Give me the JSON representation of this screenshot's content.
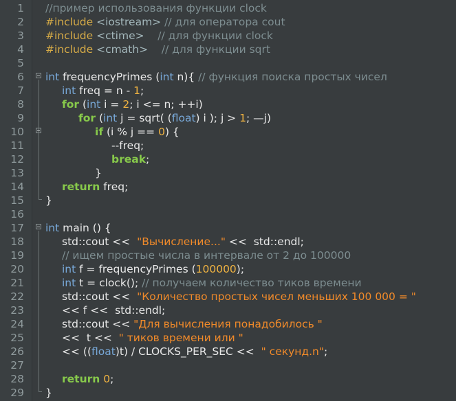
{
  "editor": {
    "lines": [
      {
        "n": "1",
        "indent": 0,
        "tokens": [
          {
            "t": "//пример использования функции clock",
            "c": "comment"
          }
        ]
      },
      {
        "n": "2",
        "indent": 0,
        "tokens": [
          {
            "t": "#include ",
            "c": "pre"
          },
          {
            "t": "<iostream>",
            "c": "angle"
          },
          {
            "t": " // для оператора cout",
            "c": "comment"
          }
        ]
      },
      {
        "n": "3",
        "indent": 0,
        "tokens": [
          {
            "t": "#include ",
            "c": "pre"
          },
          {
            "t": "<ctime>",
            "c": "angle"
          },
          {
            "t": "    // для функции clock",
            "c": "comment"
          }
        ]
      },
      {
        "n": "4",
        "indent": 0,
        "tokens": [
          {
            "t": "#include ",
            "c": "pre"
          },
          {
            "t": "<cmath>",
            "c": "angle"
          },
          {
            "t": "    // для функции sqrt",
            "c": "comment"
          }
        ]
      },
      {
        "n": "5",
        "indent": 0,
        "tokens": []
      },
      {
        "n": "6",
        "indent": 0,
        "tokens": [
          {
            "t": "int",
            "c": "type"
          },
          {
            "t": " frequencyPrimes (",
            "c": "id"
          },
          {
            "t": "int",
            "c": "type"
          },
          {
            "t": " n){ ",
            "c": "id"
          },
          {
            "t": "// функция поиска простых чисел",
            "c": "comment"
          }
        ]
      },
      {
        "n": "7",
        "indent": 1,
        "tokens": [
          {
            "t": "int",
            "c": "type"
          },
          {
            "t": " freq = n - ",
            "c": "id"
          },
          {
            "t": "1",
            "c": "num"
          },
          {
            "t": ";",
            "c": "id"
          }
        ]
      },
      {
        "n": "8",
        "indent": 1,
        "tokens": [
          {
            "t": "for",
            "c": "kw"
          },
          {
            "t": " (",
            "c": "id"
          },
          {
            "t": "int",
            "c": "type"
          },
          {
            "t": " i = ",
            "c": "id"
          },
          {
            "t": "2",
            "c": "num"
          },
          {
            "t": "; i <= n; ++i)",
            "c": "id"
          }
        ]
      },
      {
        "n": "9",
        "indent": 2,
        "tokens": [
          {
            "t": "for",
            "c": "kw"
          },
          {
            "t": " (",
            "c": "id"
          },
          {
            "t": "int",
            "c": "type"
          },
          {
            "t": " j = sqrt( (",
            "c": "id"
          },
          {
            "t": "float",
            "c": "type"
          },
          {
            "t": ") i ); j > ",
            "c": "id"
          },
          {
            "t": "1",
            "c": "num"
          },
          {
            "t": "; —j)",
            "c": "id"
          }
        ]
      },
      {
        "n": "10",
        "indent": 3,
        "tokens": [
          {
            "t": "if",
            "c": "kw"
          },
          {
            "t": " (i % j == ",
            "c": "id"
          },
          {
            "t": "0",
            "c": "num"
          },
          {
            "t": ") {",
            "c": "id"
          }
        ]
      },
      {
        "n": "11",
        "indent": 4,
        "tokens": [
          {
            "t": "--freq;",
            "c": "id"
          }
        ]
      },
      {
        "n": "12",
        "indent": 4,
        "tokens": [
          {
            "t": "break",
            "c": "kw"
          },
          {
            "t": ";",
            "c": "id"
          }
        ]
      },
      {
        "n": "13",
        "indent": 3,
        "tokens": [
          {
            "t": "}",
            "c": "id"
          }
        ]
      },
      {
        "n": "14",
        "indent": 1,
        "tokens": [
          {
            "t": "return",
            "c": "kw"
          },
          {
            "t": " freq;",
            "c": "id"
          }
        ]
      },
      {
        "n": "15",
        "indent": 0,
        "tokens": [
          {
            "t": "}",
            "c": "id"
          }
        ]
      },
      {
        "n": "16",
        "indent": 0,
        "tokens": []
      },
      {
        "n": "17",
        "indent": 0,
        "tokens": [
          {
            "t": "int",
            "c": "type"
          },
          {
            "t": " main () {",
            "c": "id"
          }
        ]
      },
      {
        "n": "18",
        "indent": 1,
        "tokens": [
          {
            "t": "std::cout << ",
            "c": "id"
          },
          {
            "t": " \"Вычисление...\"",
            "c": "str"
          },
          {
            "t": " << ",
            "c": "id"
          },
          {
            "t": " std::endl;",
            "c": "id"
          }
        ]
      },
      {
        "n": "19",
        "indent": 1,
        "tokens": [
          {
            "t": "// ищем простые числа в интервале от 2 до 100000",
            "c": "comment"
          }
        ]
      },
      {
        "n": "20",
        "indent": 1,
        "tokens": [
          {
            "t": "int",
            "c": "type"
          },
          {
            "t": " f = frequencyPrimes (",
            "c": "id"
          },
          {
            "t": "100000",
            "c": "num"
          },
          {
            "t": ");",
            "c": "id"
          }
        ]
      },
      {
        "n": "21",
        "indent": 1,
        "tokens": [
          {
            "t": "int",
            "c": "type"
          },
          {
            "t": " t = clock(); ",
            "c": "id"
          },
          {
            "t": "// получаем количество тиков времени",
            "c": "comment"
          }
        ]
      },
      {
        "n": "22",
        "indent": 1,
        "tokens": [
          {
            "t": "std::cout << ",
            "c": "id"
          },
          {
            "t": " \"Количество простых чисел меньших 100 000 = \"",
            "c": "str"
          }
        ]
      },
      {
        "n": "23",
        "indent": 1,
        "tokens": [
          {
            "t": "<< f << ",
            "c": "id"
          },
          {
            "t": " std::endl;",
            "c": "id"
          }
        ]
      },
      {
        "n": "24",
        "indent": 1,
        "tokens": [
          {
            "t": "std::cout << ",
            "c": "id"
          },
          {
            "t": "\"Для вычисления понадобилось \"",
            "c": "str"
          }
        ]
      },
      {
        "n": "25",
        "indent": 1,
        "tokens": [
          {
            "t": "<<  t << ",
            "c": "id"
          },
          {
            "t": " \" тиков времени или \"",
            "c": "str"
          }
        ]
      },
      {
        "n": "26",
        "indent": 1,
        "tokens": [
          {
            "t": "<< ((",
            "c": "id"
          },
          {
            "t": "float",
            "c": "type"
          },
          {
            "t": ")t) / CLOCKS_PER_SEC << ",
            "c": "id"
          },
          {
            "t": " \" секунд.n\"",
            "c": "str"
          },
          {
            "t": ";",
            "c": "id"
          }
        ]
      },
      {
        "n": "27",
        "indent": 0,
        "tokens": []
      },
      {
        "n": "28",
        "indent": 1,
        "tokens": [
          {
            "t": "return",
            "c": "kw"
          },
          {
            "t": " ",
            "c": "id"
          },
          {
            "t": "0",
            "c": "num"
          },
          {
            "t": ";",
            "c": "id"
          }
        ]
      },
      {
        "n": "29",
        "indent": 0,
        "tokens": [
          {
            "t": "}",
            "c": "id"
          }
        ]
      }
    ]
  },
  "colors": {
    "background": "#383c3e",
    "gutter": "#3a3f41",
    "line_number": "#8f9a9c",
    "comment": "#7d8d90",
    "preprocessor": "#d6ab47",
    "type": "#78a8d8",
    "keyword": "#87c94b",
    "number": "#f0b341",
    "string": "#f08a2a",
    "text": "#e8e8e8"
  }
}
